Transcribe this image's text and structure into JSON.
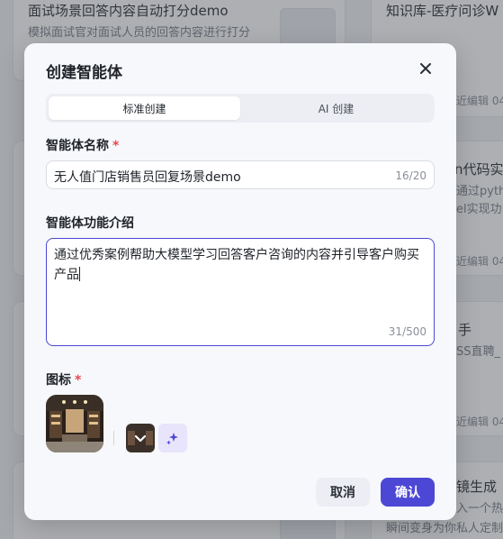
{
  "background": {
    "cards": [
      {
        "title": "面试场景回答内容自动打分demo",
        "desc": "模拟面试官对面试人员的回答内容进行打分"
      },
      {
        "title": "知识库-医疗问诊W"
      },
      {
        "title": "n代码实",
        "desc1": "通过pytho",
        "desc2": "el实现功"
      },
      {
        "title": "手",
        "desc": "SS直聘_"
      },
      {
        "title": "镜生成",
        "desc1": "入一个热门",
        "desc2": "瞬间变身为你私人定制"
      }
    ],
    "meta": [
      "近编辑 04",
      "近编辑 04",
      "近编辑 04",
      "近编辑 04"
    ]
  },
  "modal": {
    "title": "创建智能体",
    "tabs": [
      {
        "label": "标准创建",
        "active": true
      },
      {
        "label": "AI 创建",
        "active": false
      }
    ],
    "name_label": "智能体名称",
    "name_value": "无人值门店销售员回复场景demo",
    "name_count": "16/20",
    "desc_label": "智能体功能介绍",
    "desc_value": "通过优秀案例帮助大模型学习回答客户咨询的内容并引导客户购买产品",
    "desc_count": "31/500",
    "icon_label": "图标",
    "required_mark": "*",
    "cancel_label": "取消",
    "confirm_label": "确认"
  },
  "colors": {
    "accent": "#4d47d6",
    "required": "#e5484d",
    "overlay": "rgba(60,64,72,0.42)"
  },
  "icons": [
    "close-icon",
    "store-image-icon",
    "chevron-down-icon",
    "sparkle-icon"
  ]
}
